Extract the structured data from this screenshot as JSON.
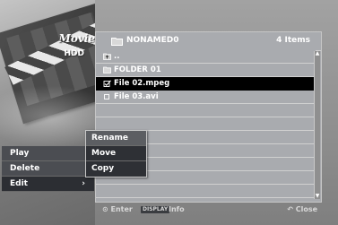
{
  "header": {
    "section": "Movie",
    "device": "HDD"
  },
  "left_menu": {
    "items": [
      {
        "label": "Play",
        "arrow": ""
      },
      {
        "label": "Delete",
        "arrow": ""
      },
      {
        "label": "Edit",
        "arrow": "›"
      }
    ]
  },
  "submenu": {
    "items": [
      {
        "label": "Rename"
      },
      {
        "label": "Move"
      },
      {
        "label": "Copy"
      }
    ]
  },
  "file_list": {
    "folder_name": "NONAMED0",
    "item_count": "4 Items",
    "rows": [
      {
        "label": "..",
        "icon": "parent-folder-icon"
      },
      {
        "label": "FOLDER 01",
        "icon": "folder-icon"
      },
      {
        "label": "File 02.mpeg",
        "icon": "checked-file-icon"
      },
      {
        "label": "File 03.avi",
        "icon": "file-icon"
      }
    ]
  },
  "bottom_bar": {
    "enter": "Enter",
    "display_key": "DISPLAY",
    "info": "Info",
    "close": "Close"
  }
}
